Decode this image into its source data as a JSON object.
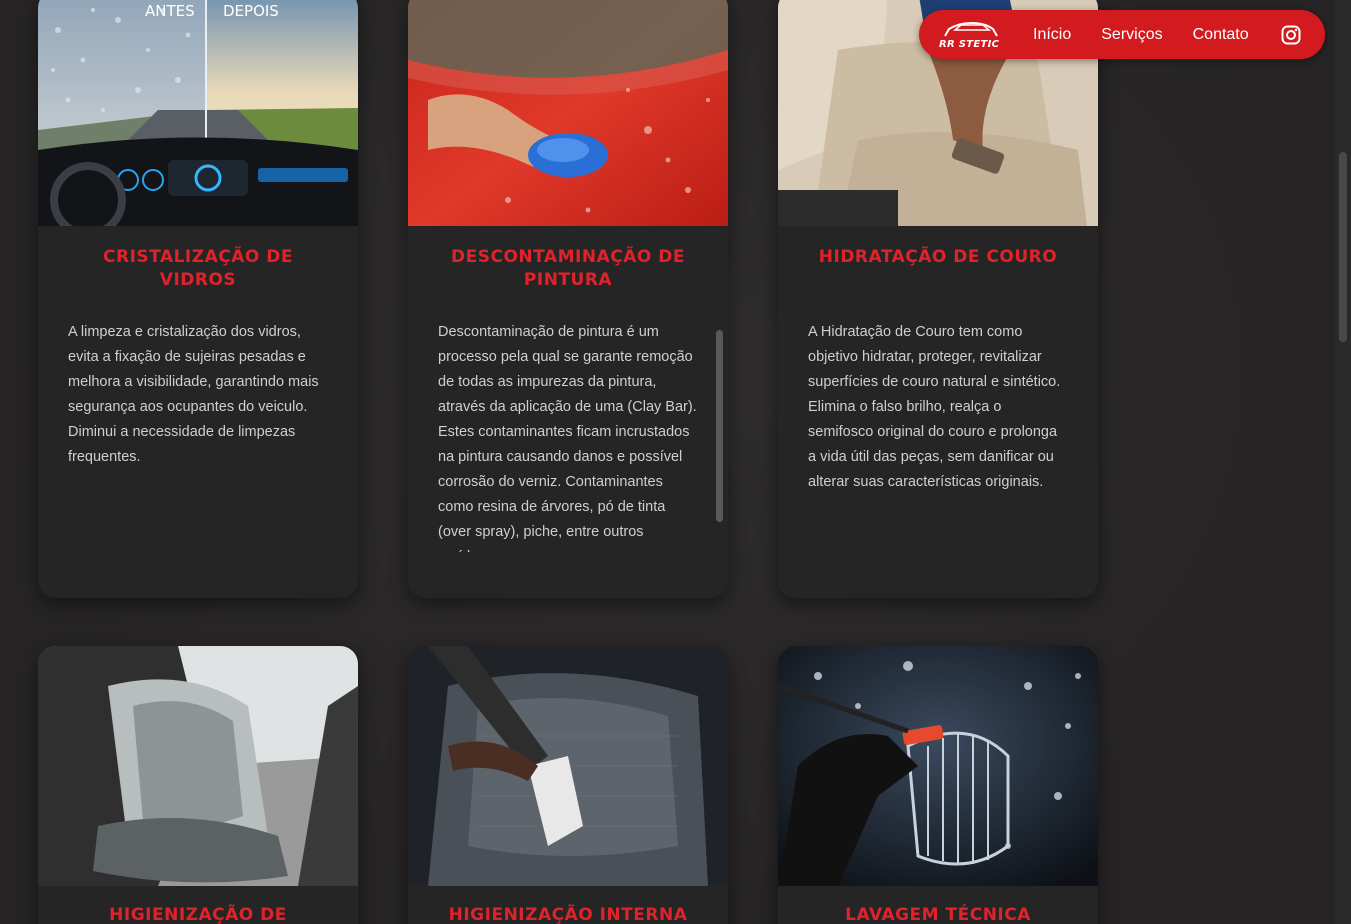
{
  "nav": {
    "logo_text": "RR STETIC",
    "links": [
      "Início",
      "Serviços",
      "Contato"
    ],
    "instagram_icon": "instagram-icon",
    "background_color": "#d31b1f"
  },
  "cards": [
    {
      "title": "Cristalização de Vidros",
      "photo_labels": {
        "before": "ANTES",
        "after": "DEPOIS"
      },
      "description": "A limpeza e cristalização dos vidros, evita a fixação de sujeiras pesadas e melhora a visibilidade, garantindo mais segurança aos ocupantes do veiculo. Diminui a necessidade de limpezas frequentes."
    },
    {
      "title": "Descontaminação de Pintura",
      "description": "Descontaminação de pintura é um processo pela qual se garante remoção de todas as impurezas da pintura, através da aplicação de uma (Clay Bar). Estes contaminantes ficam incrustados na pintura causando danos e possível corrosão do verniz. Contaminantes como resina de árvores, pó de tinta (over spray), piche, entre outros resíduos."
    },
    {
      "title": "Hidratação de Couro",
      "description": "A Hidratação de Couro tem como objetivo hidratar, proteger, revitalizar superfícies de couro natural e sintético. Elimina o falso brilho, realça o semifosco original do couro e prolonga a vida útil das peças, sem danificar ou alterar suas características originais."
    },
    {
      "title": "Higienização de"
    },
    {
      "title": "Higienização Interna"
    },
    {
      "title": "Lavagem Técnica"
    }
  ],
  "colors": {
    "accent": "#e0222a",
    "background": "#272626",
    "card": "#262525",
    "text": "#cfcfcf"
  }
}
